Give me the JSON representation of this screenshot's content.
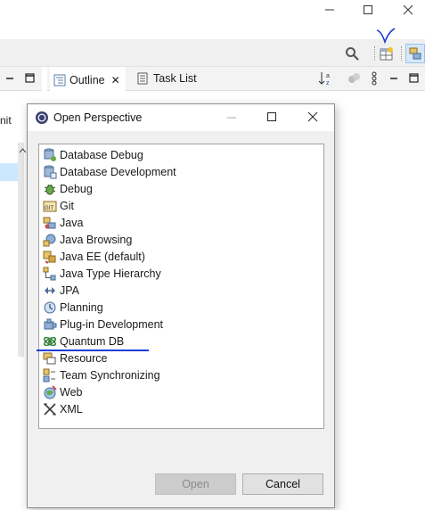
{
  "window": {
    "minimize_glyph": "—",
    "maximize_glyph": "☐",
    "close_glyph": "✕"
  },
  "toolbar": {
    "icons": [
      "search-icon",
      "open-perspective-icon",
      "java-perspective-icon"
    ]
  },
  "left_view": {
    "stub_text": "nit"
  },
  "views": {
    "tabs": [
      {
        "label": "Outline",
        "icon": "outline-icon",
        "close": "✕"
      },
      {
        "label": "Task List",
        "icon": "task-list-icon"
      }
    ]
  },
  "dialog": {
    "title": "Open Perspective",
    "perspectives": [
      {
        "label": "Database Debug",
        "icon": "database-debug-icon"
      },
      {
        "label": "Database Development",
        "icon": "database-development-icon"
      },
      {
        "label": "Debug",
        "icon": "debug-icon"
      },
      {
        "label": "Git",
        "icon": "git-icon"
      },
      {
        "label": "Java",
        "icon": "java-icon"
      },
      {
        "label": "Java Browsing",
        "icon": "java-browsing-icon"
      },
      {
        "label": "Java EE (default)",
        "icon": "java-ee-icon"
      },
      {
        "label": "Java Type Hierarchy",
        "icon": "type-hierarchy-icon"
      },
      {
        "label": "JPA",
        "icon": "jpa-icon"
      },
      {
        "label": "Planning",
        "icon": "planning-icon"
      },
      {
        "label": "Plug-in Development",
        "icon": "plugin-icon"
      },
      {
        "label": "Quantum DB",
        "icon": "quantum-db-icon"
      },
      {
        "label": "Resource",
        "icon": "resource-icon"
      },
      {
        "label": "Team Synchronizing",
        "icon": "team-sync-icon"
      },
      {
        "label": "Web",
        "icon": "web-icon"
      },
      {
        "label": "XML",
        "icon": "xml-icon"
      }
    ],
    "open_label": "Open",
    "cancel_label": "Cancel"
  },
  "colors": {
    "annotation": "#1a3fd6",
    "selection": "#cce8ff",
    "disabled_button": "#cccccc"
  }
}
